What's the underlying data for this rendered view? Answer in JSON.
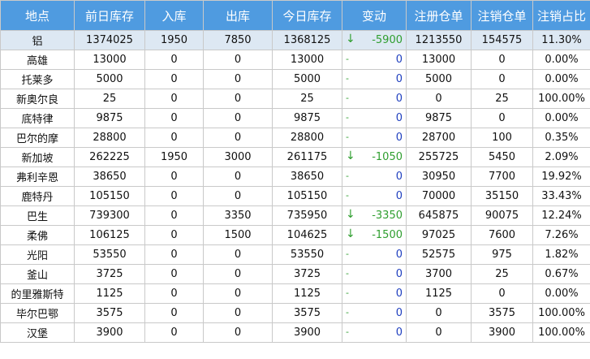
{
  "headers": [
    "地点",
    "前日库存",
    "入库",
    "出库",
    "今日库存",
    "变动",
    "注册仓单",
    "注销仓单",
    "注销占比"
  ],
  "rows": [
    {
      "loc": "铝",
      "prev": "1374025",
      "in": "1950",
      "out": "7850",
      "today": "1368125",
      "arrow": "↓",
      "change": "-5900",
      "reg": "1213550",
      "cancel": "154575",
      "ratio": "11.30%",
      "dir": "down",
      "total": true
    },
    {
      "loc": "高雄",
      "prev": "13000",
      "in": "0",
      "out": "0",
      "today": "13000",
      "arrow": "-",
      "change": "0",
      "reg": "13000",
      "cancel": "0",
      "ratio": "0.00%",
      "dir": "flat"
    },
    {
      "loc": "托莱多",
      "prev": "5000",
      "in": "0",
      "out": "0",
      "today": "5000",
      "arrow": "-",
      "change": "0",
      "reg": "5000",
      "cancel": "0",
      "ratio": "0.00%",
      "dir": "flat"
    },
    {
      "loc": "新奥尔良",
      "prev": "25",
      "in": "0",
      "out": "0",
      "today": "25",
      "arrow": "-",
      "change": "0",
      "reg": "0",
      "cancel": "25",
      "ratio": "100.00%",
      "dir": "flat"
    },
    {
      "loc": "底特律",
      "prev": "9875",
      "in": "0",
      "out": "0",
      "today": "9875",
      "arrow": "-",
      "change": "0",
      "reg": "9875",
      "cancel": "0",
      "ratio": "0.00%",
      "dir": "flat"
    },
    {
      "loc": "巴尔的摩",
      "prev": "28800",
      "in": "0",
      "out": "0",
      "today": "28800",
      "arrow": "-",
      "change": "0",
      "reg": "28700",
      "cancel": "100",
      "ratio": "0.35%",
      "dir": "flat"
    },
    {
      "loc": "新加坡",
      "prev": "262225",
      "in": "1950",
      "out": "3000",
      "today": "261175",
      "arrow": "↓",
      "change": "-1050",
      "reg": "255725",
      "cancel": "5450",
      "ratio": "2.09%",
      "dir": "down"
    },
    {
      "loc": "弗利辛恩",
      "prev": "38650",
      "in": "0",
      "out": "0",
      "today": "38650",
      "arrow": "-",
      "change": "0",
      "reg": "30950",
      "cancel": "7700",
      "ratio": "19.92%",
      "dir": "flat"
    },
    {
      "loc": "鹿特丹",
      "prev": "105150",
      "in": "0",
      "out": "0",
      "today": "105150",
      "arrow": "-",
      "change": "0",
      "reg": "70000",
      "cancel": "35150",
      "ratio": "33.43%",
      "dir": "flat"
    },
    {
      "loc": "巴生",
      "prev": "739300",
      "in": "0",
      "out": "3350",
      "today": "735950",
      "arrow": "↓",
      "change": "-3350",
      "reg": "645875",
      "cancel": "90075",
      "ratio": "12.24%",
      "dir": "down"
    },
    {
      "loc": "柔佛",
      "prev": "106125",
      "in": "0",
      "out": "1500",
      "today": "104625",
      "arrow": "↓",
      "change": "-1500",
      "reg": "97025",
      "cancel": "7600",
      "ratio": "7.26%",
      "dir": "down"
    },
    {
      "loc": "光阳",
      "prev": "53550",
      "in": "0",
      "out": "0",
      "today": "53550",
      "arrow": "-",
      "change": "0",
      "reg": "52575",
      "cancel": "975",
      "ratio": "1.82%",
      "dir": "flat"
    },
    {
      "loc": "釜山",
      "prev": "3725",
      "in": "0",
      "out": "0",
      "today": "3725",
      "arrow": "-",
      "change": "0",
      "reg": "3700",
      "cancel": "25",
      "ratio": "0.67%",
      "dir": "flat"
    },
    {
      "loc": "的里雅斯特",
      "prev": "1125",
      "in": "0",
      "out": "0",
      "today": "1125",
      "arrow": "-",
      "change": "0",
      "reg": "1125",
      "cancel": "0",
      "ratio": "0.00%",
      "dir": "flat"
    },
    {
      "loc": "毕尔巴鄂",
      "prev": "3575",
      "in": "0",
      "out": "0",
      "today": "3575",
      "arrow": "-",
      "change": "0",
      "reg": "0",
      "cancel": "3575",
      "ratio": "100.00%",
      "dir": "flat"
    },
    {
      "loc": "汉堡",
      "prev": "3900",
      "in": "0",
      "out": "0",
      "today": "3900",
      "arrow": "-",
      "change": "0",
      "reg": "0",
      "cancel": "3900",
      "ratio": "100.00%",
      "dir": "flat"
    }
  ]
}
